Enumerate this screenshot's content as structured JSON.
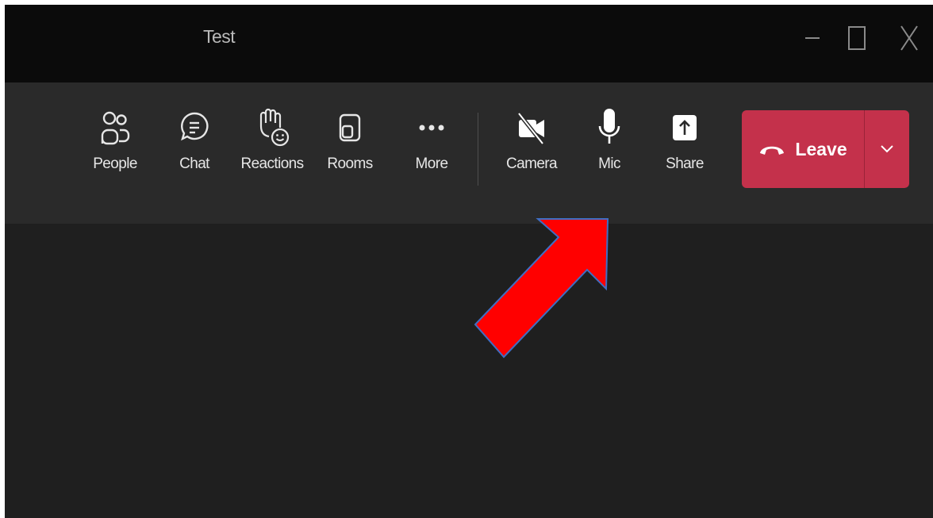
{
  "window": {
    "title": "Test",
    "controls": {
      "minimize": "minimize-icon",
      "maximize": "maximize-icon",
      "close": "close-icon"
    }
  },
  "toolbar": {
    "items": [
      {
        "id": "people",
        "label": "People",
        "icon": "people-icon"
      },
      {
        "id": "chat",
        "label": "Chat",
        "icon": "chat-icon"
      },
      {
        "id": "reactions",
        "label": "Reactions",
        "icon": "raise-hand-reaction-icon"
      },
      {
        "id": "rooms",
        "label": "Rooms",
        "icon": "breakout-rooms-icon"
      },
      {
        "id": "more",
        "label": "More",
        "icon": "more-dots-icon"
      }
    ],
    "media": [
      {
        "id": "camera",
        "label": "Camera",
        "icon": "camera-off-icon"
      },
      {
        "id": "mic",
        "label": "Mic",
        "icon": "microphone-icon"
      },
      {
        "id": "share",
        "label": "Share",
        "icon": "share-screen-icon"
      }
    ],
    "leave": {
      "label": "Leave",
      "icon": "hang-up-icon",
      "dropdown_icon": "chevron-down-icon"
    }
  },
  "colors": {
    "titlebar": "#0b0b0b",
    "toolbar": "#2a2a2a",
    "stage": "#1f1f1f",
    "leave": "#c4314b",
    "annotation_arrow": "#ff0000",
    "annotation_outline": "#3f6ec4"
  },
  "annotation": {
    "type": "arrow",
    "points_to": "mic"
  }
}
